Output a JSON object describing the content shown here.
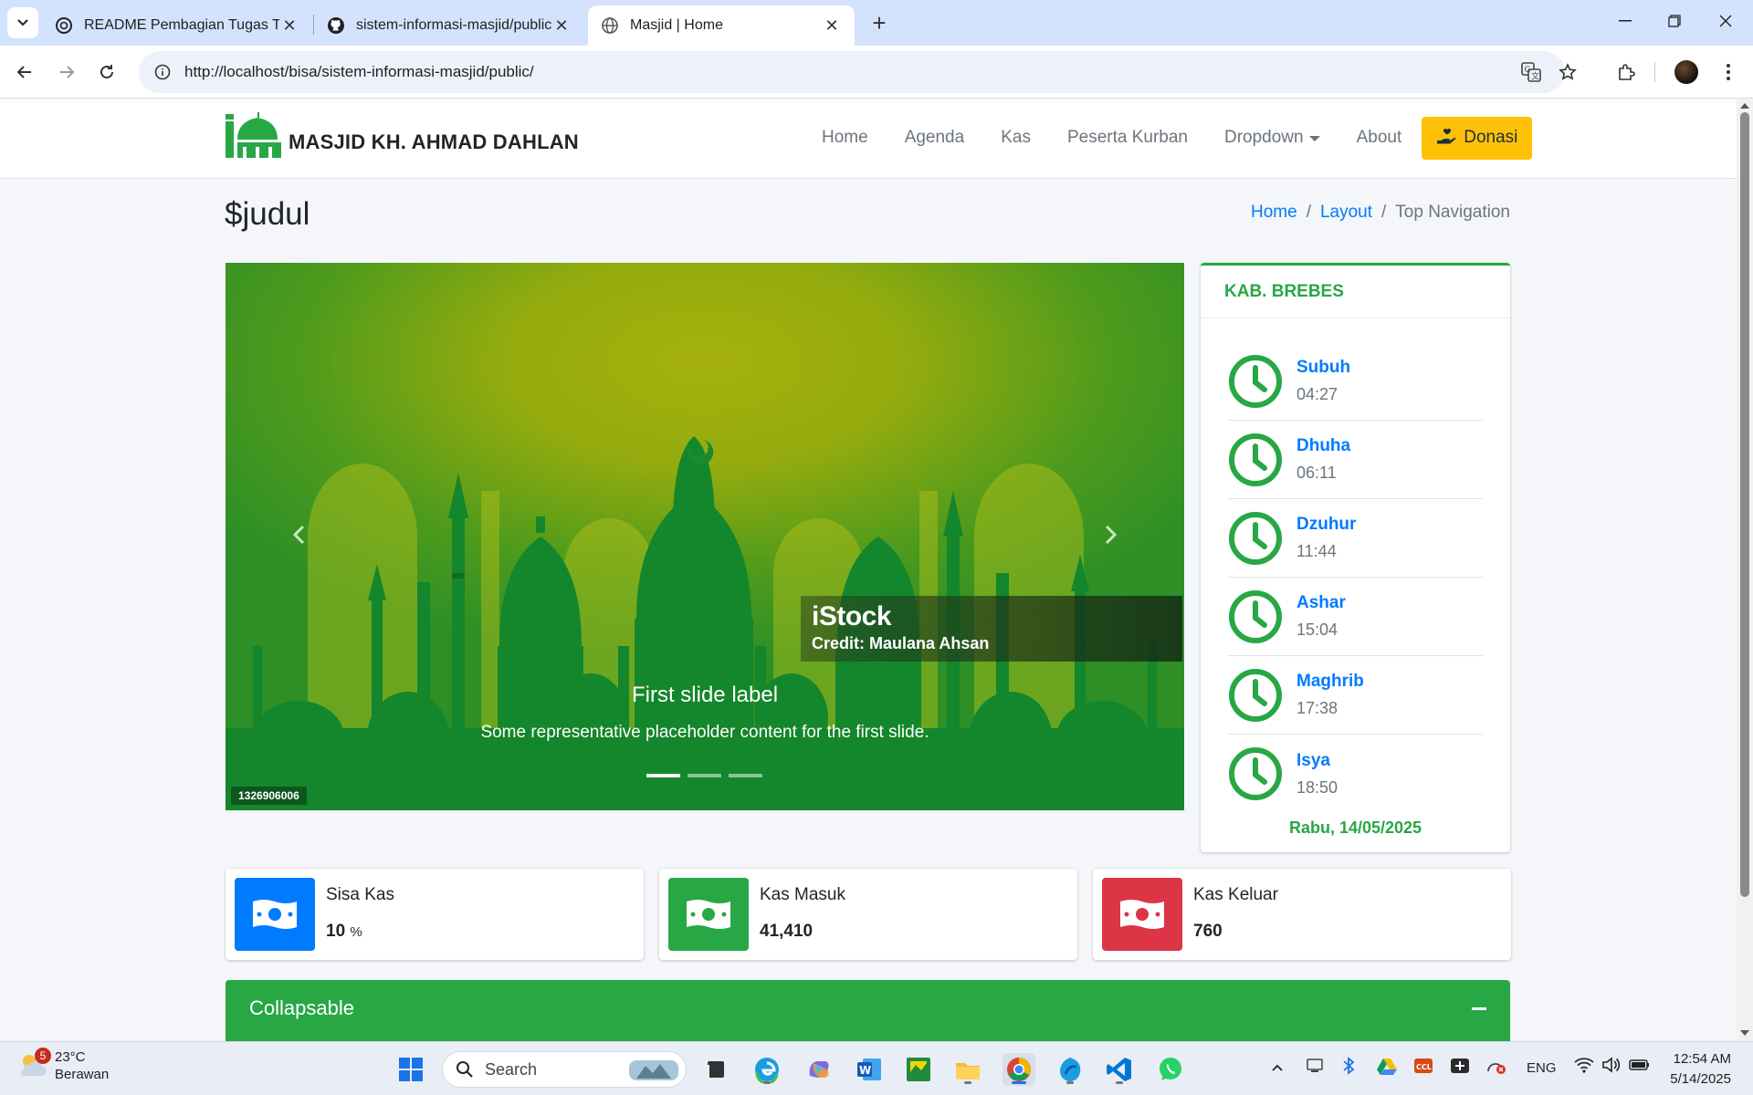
{
  "browser": {
    "tabs": [
      {
        "title": "README Pembagian Tugas Tim",
        "icon": "openai-icon"
      },
      {
        "title": "sistem-informasi-masjid/public",
        "icon": "github-icon"
      },
      {
        "title": "Masjid | Home",
        "icon": "globe-icon"
      }
    ],
    "url": "http://localhost/bisa/sistem-informasi-masjid/public/"
  },
  "site": {
    "brand": "MASJID KH. AHMAD DAHLAN",
    "menu": [
      "Home",
      "Agenda",
      "Kas",
      "Peserta Kurban",
      "Dropdown",
      "About"
    ],
    "donate_label": "Donasi",
    "page_title": "$judul",
    "breadcrumb": [
      "Home",
      "Layout",
      "Top Navigation"
    ]
  },
  "carousel": {
    "watermark": "iStock",
    "credit": "Credit: Maulana Ahsan",
    "caption_title": "First slide label",
    "caption_text": "Some representative placeholder content for the first slide.",
    "stock_id": "1326906006",
    "slides": 3,
    "active_slide": 1
  },
  "prayer": {
    "region": "KAB. BREBES",
    "times": [
      {
        "name": "Subuh",
        "time": "04:27"
      },
      {
        "name": "Dhuha",
        "time": "06:11"
      },
      {
        "name": "Dzuhur",
        "time": "11:44"
      },
      {
        "name": "Ashar",
        "time": "15:04"
      },
      {
        "name": "Maghrib",
        "time": "17:38"
      },
      {
        "name": "Isya",
        "time": "18:50"
      }
    ],
    "date": "Rabu, 14/05/2025"
  },
  "stats": [
    {
      "label": "Sisa Kas",
      "value": "10",
      "unit": "%",
      "color": "#007bff"
    },
    {
      "label": "Kas Masuk",
      "value": "41,410",
      "unit": "",
      "color": "#28a745"
    },
    {
      "label": "Kas Keluar",
      "value": "760",
      "unit": "",
      "color": "#dc3545"
    }
  ],
  "collapse": {
    "title": "Collapsable"
  },
  "taskbar": {
    "temperature": "23°C",
    "condition": "Berawan",
    "notif_count": "5",
    "search_placeholder": "Search",
    "language": "ENG",
    "time": "12:54 AM",
    "date": "5/14/2025"
  },
  "colors": {
    "brand_green": "#28a745",
    "donate_yellow": "#ffc107",
    "link_blue": "#007bff",
    "danger_red": "#dc3545"
  }
}
